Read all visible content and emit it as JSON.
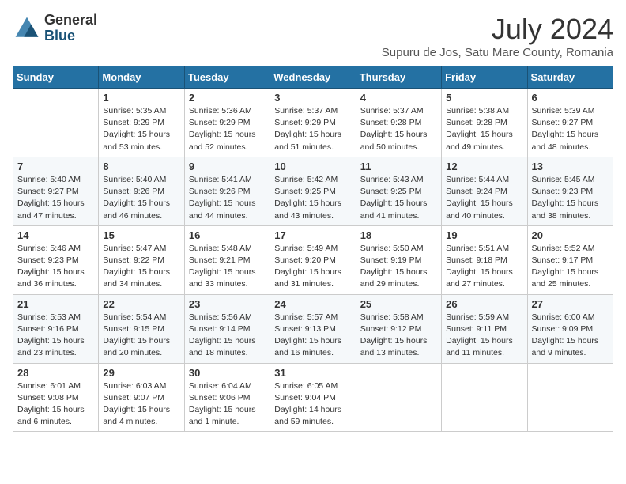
{
  "logo": {
    "general": "General",
    "blue": "Blue"
  },
  "title": {
    "month_year": "July 2024",
    "location": "Supuru de Jos, Satu Mare County, Romania"
  },
  "days_of_week": [
    "Sunday",
    "Monday",
    "Tuesday",
    "Wednesday",
    "Thursday",
    "Friday",
    "Saturday"
  ],
  "weeks": [
    [
      {
        "day": "",
        "info": ""
      },
      {
        "day": "1",
        "info": "Sunrise: 5:35 AM\nSunset: 9:29 PM\nDaylight: 15 hours\nand 53 minutes."
      },
      {
        "day": "2",
        "info": "Sunrise: 5:36 AM\nSunset: 9:29 PM\nDaylight: 15 hours\nand 52 minutes."
      },
      {
        "day": "3",
        "info": "Sunrise: 5:37 AM\nSunset: 9:29 PM\nDaylight: 15 hours\nand 51 minutes."
      },
      {
        "day": "4",
        "info": "Sunrise: 5:37 AM\nSunset: 9:28 PM\nDaylight: 15 hours\nand 50 minutes."
      },
      {
        "day": "5",
        "info": "Sunrise: 5:38 AM\nSunset: 9:28 PM\nDaylight: 15 hours\nand 49 minutes."
      },
      {
        "day": "6",
        "info": "Sunrise: 5:39 AM\nSunset: 9:27 PM\nDaylight: 15 hours\nand 48 minutes."
      }
    ],
    [
      {
        "day": "7",
        "info": "Sunrise: 5:40 AM\nSunset: 9:27 PM\nDaylight: 15 hours\nand 47 minutes."
      },
      {
        "day": "8",
        "info": "Sunrise: 5:40 AM\nSunset: 9:26 PM\nDaylight: 15 hours\nand 46 minutes."
      },
      {
        "day": "9",
        "info": "Sunrise: 5:41 AM\nSunset: 9:26 PM\nDaylight: 15 hours\nand 44 minutes."
      },
      {
        "day": "10",
        "info": "Sunrise: 5:42 AM\nSunset: 9:25 PM\nDaylight: 15 hours\nand 43 minutes."
      },
      {
        "day": "11",
        "info": "Sunrise: 5:43 AM\nSunset: 9:25 PM\nDaylight: 15 hours\nand 41 minutes."
      },
      {
        "day": "12",
        "info": "Sunrise: 5:44 AM\nSunset: 9:24 PM\nDaylight: 15 hours\nand 40 minutes."
      },
      {
        "day": "13",
        "info": "Sunrise: 5:45 AM\nSunset: 9:23 PM\nDaylight: 15 hours\nand 38 minutes."
      }
    ],
    [
      {
        "day": "14",
        "info": "Sunrise: 5:46 AM\nSunset: 9:23 PM\nDaylight: 15 hours\nand 36 minutes."
      },
      {
        "day": "15",
        "info": "Sunrise: 5:47 AM\nSunset: 9:22 PM\nDaylight: 15 hours\nand 34 minutes."
      },
      {
        "day": "16",
        "info": "Sunrise: 5:48 AM\nSunset: 9:21 PM\nDaylight: 15 hours\nand 33 minutes."
      },
      {
        "day": "17",
        "info": "Sunrise: 5:49 AM\nSunset: 9:20 PM\nDaylight: 15 hours\nand 31 minutes."
      },
      {
        "day": "18",
        "info": "Sunrise: 5:50 AM\nSunset: 9:19 PM\nDaylight: 15 hours\nand 29 minutes."
      },
      {
        "day": "19",
        "info": "Sunrise: 5:51 AM\nSunset: 9:18 PM\nDaylight: 15 hours\nand 27 minutes."
      },
      {
        "day": "20",
        "info": "Sunrise: 5:52 AM\nSunset: 9:17 PM\nDaylight: 15 hours\nand 25 minutes."
      }
    ],
    [
      {
        "day": "21",
        "info": "Sunrise: 5:53 AM\nSunset: 9:16 PM\nDaylight: 15 hours\nand 23 minutes."
      },
      {
        "day": "22",
        "info": "Sunrise: 5:54 AM\nSunset: 9:15 PM\nDaylight: 15 hours\nand 20 minutes."
      },
      {
        "day": "23",
        "info": "Sunrise: 5:56 AM\nSunset: 9:14 PM\nDaylight: 15 hours\nand 18 minutes."
      },
      {
        "day": "24",
        "info": "Sunrise: 5:57 AM\nSunset: 9:13 PM\nDaylight: 15 hours\nand 16 minutes."
      },
      {
        "day": "25",
        "info": "Sunrise: 5:58 AM\nSunset: 9:12 PM\nDaylight: 15 hours\nand 13 minutes."
      },
      {
        "day": "26",
        "info": "Sunrise: 5:59 AM\nSunset: 9:11 PM\nDaylight: 15 hours\nand 11 minutes."
      },
      {
        "day": "27",
        "info": "Sunrise: 6:00 AM\nSunset: 9:09 PM\nDaylight: 15 hours\nand 9 minutes."
      }
    ],
    [
      {
        "day": "28",
        "info": "Sunrise: 6:01 AM\nSunset: 9:08 PM\nDaylight: 15 hours\nand 6 minutes."
      },
      {
        "day": "29",
        "info": "Sunrise: 6:03 AM\nSunset: 9:07 PM\nDaylight: 15 hours\nand 4 minutes."
      },
      {
        "day": "30",
        "info": "Sunrise: 6:04 AM\nSunset: 9:06 PM\nDaylight: 15 hours\nand 1 minute."
      },
      {
        "day": "31",
        "info": "Sunrise: 6:05 AM\nSunset: 9:04 PM\nDaylight: 14 hours\nand 59 minutes."
      },
      {
        "day": "",
        "info": ""
      },
      {
        "day": "",
        "info": ""
      },
      {
        "day": "",
        "info": ""
      }
    ]
  ]
}
